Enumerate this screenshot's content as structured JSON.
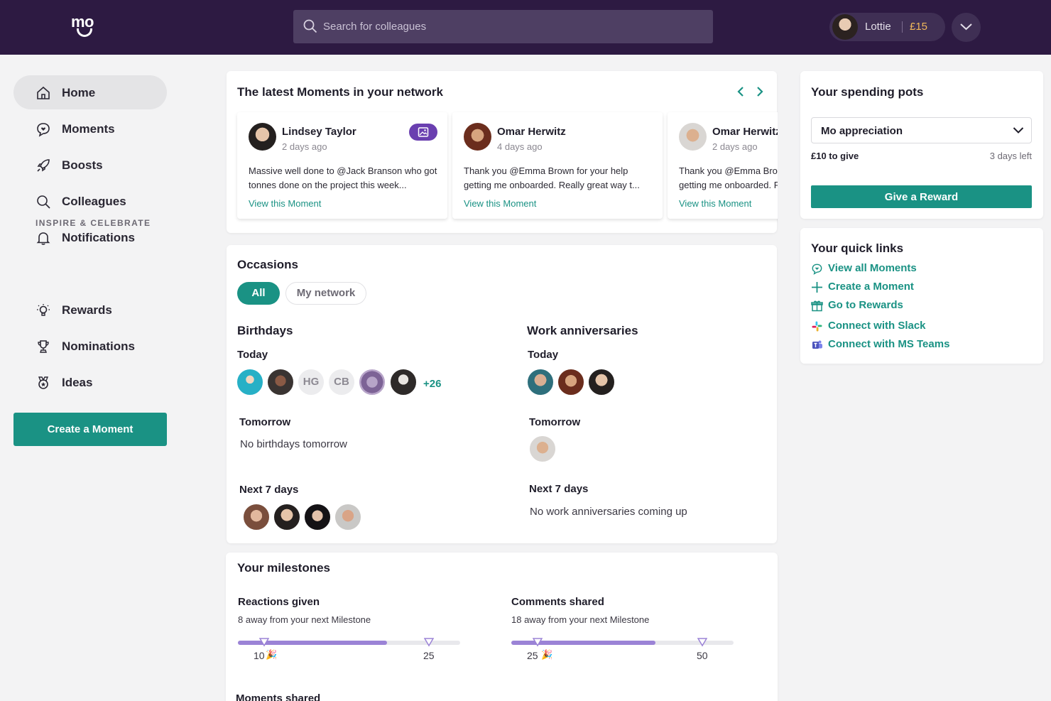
{
  "header": {
    "logo": "mo",
    "search_placeholder": "Search for colleagues",
    "user_name": "Lottie",
    "user_balance": "£15"
  },
  "sidebar": {
    "items": [
      {
        "label": "Home",
        "icon": "home-icon"
      },
      {
        "label": "Moments",
        "icon": "chat-heart-icon"
      },
      {
        "label": "Boosts",
        "icon": "rocket-icon"
      },
      {
        "label": "Colleagues",
        "icon": "search-icon"
      },
      {
        "label": "Notifications",
        "icon": "bell-icon"
      }
    ],
    "section_label": "INSPIRE & CELEBRATE",
    "section_items": [
      {
        "label": "Rewards",
        "icon": "lightbulb-icon"
      },
      {
        "label": "Nominations",
        "icon": "trophy-icon"
      },
      {
        "label": "Ideas",
        "icon": "badge-icon"
      }
    ],
    "create_button": "Create a Moment"
  },
  "moments": {
    "title": "The latest Moments in your network",
    "items": [
      {
        "name": "Lindsey Taylor",
        "time": "2 days ago",
        "text": "Massive well done to @Jack Branson who got tonnes done on the project this week...",
        "link": "View this Moment"
      },
      {
        "name": "Omar Herwitz",
        "time": "4 days ago",
        "text": "Thank you @Emma Brown for your help getting me onboarded. Really great way t...",
        "link": "View this Moment"
      },
      {
        "name": "Omar Herwitz",
        "time": "2 days ago",
        "text": "Thank you @Emma Brown for your help getting me onboarded. Really great way t...",
        "link": "View this Moment"
      }
    ]
  },
  "occasions": {
    "title": "Occasions",
    "filters": [
      "All",
      "My network"
    ],
    "birthdays": {
      "title": "Birthdays",
      "today_label": "Today",
      "today_initials": [
        "HG",
        "CB"
      ],
      "today_more": "+26",
      "tomorrow_label": "Tomorrow",
      "tomorrow_text": "No birthdays tomorrow",
      "next_label": "Next 7 days"
    },
    "anniversaries": {
      "title": "Work anniversaries",
      "today_label": "Today",
      "tomorrow_label": "Tomorrow",
      "next_label": "Next 7 days",
      "next_text": "No work anniversaries coming up"
    }
  },
  "milestones": {
    "title": "Your milestones",
    "items": [
      {
        "label": "Reactions given",
        "sub": "8 away from your next Milestone",
        "current": "10",
        "next": "25",
        "progress": 0.67
      },
      {
        "label": "Comments shared",
        "sub": "18 away from your next Milestone",
        "current": "25",
        "next": "50",
        "progress": 0.65
      }
    ],
    "cut_off_label": "Moments shared"
  },
  "pots": {
    "title": "Your spending pots",
    "selected": "Mo appreciation",
    "amount": "£10 to give",
    "days_left": "3 days left",
    "button": "Give a Reward"
  },
  "quick_links": {
    "title": "Your quick links",
    "items": [
      {
        "label": "View all Moments",
        "icon": "chat-heart-icon"
      },
      {
        "label": "Create a Moment",
        "icon": "plus-icon"
      },
      {
        "label": "Go to Rewards",
        "icon": "gift-icon"
      },
      {
        "label": "Connect with Slack",
        "icon": "slack-icon"
      },
      {
        "label": "Connect with MS Teams",
        "icon": "teams-icon"
      }
    ]
  },
  "colors": {
    "accent": "#1a9284",
    "header_bg": "#2d1a42",
    "milestone": "#9b83d6"
  }
}
